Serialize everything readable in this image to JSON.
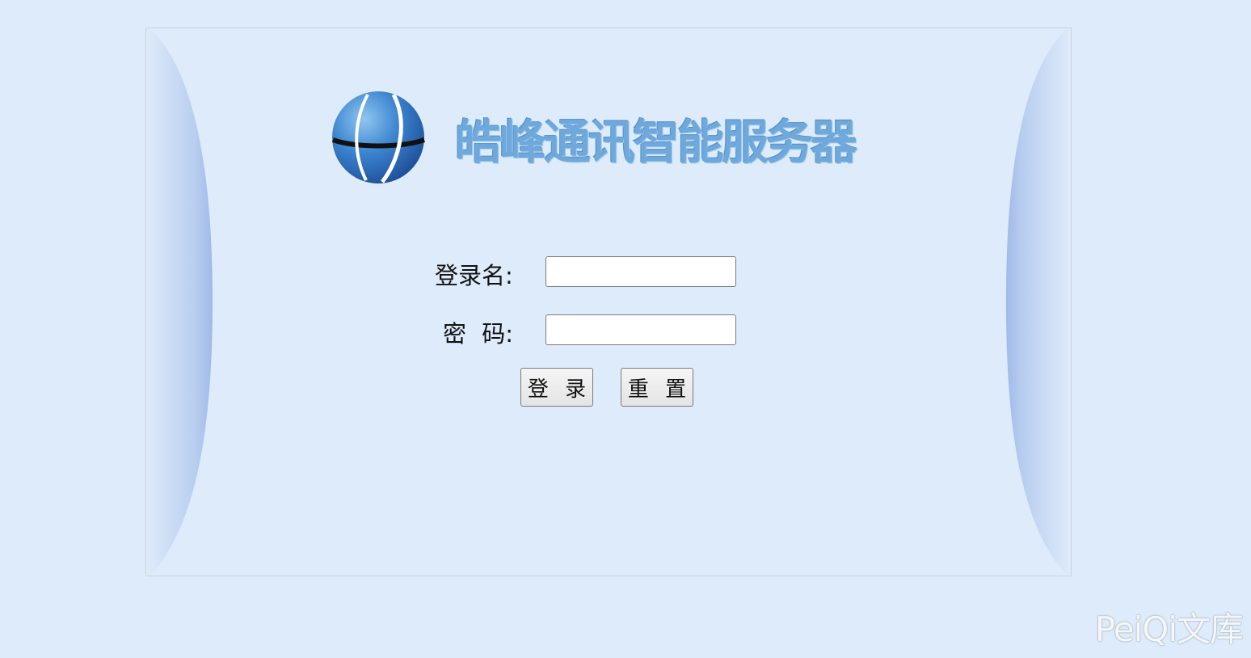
{
  "brand": {
    "logo_icon": "globe-logo-icon",
    "title": "皓峰通讯智能服务器"
  },
  "login_form": {
    "username_label": "登录名:",
    "username_value": "",
    "password_label": "密 码:",
    "password_value": "",
    "login_button": "登 录",
    "reset_button": "重 置"
  },
  "watermark": "PeiQi文库",
  "colors": {
    "background": "#deebfb",
    "logo_text": "#6fa9dc",
    "globe": "#2f73c0"
  }
}
